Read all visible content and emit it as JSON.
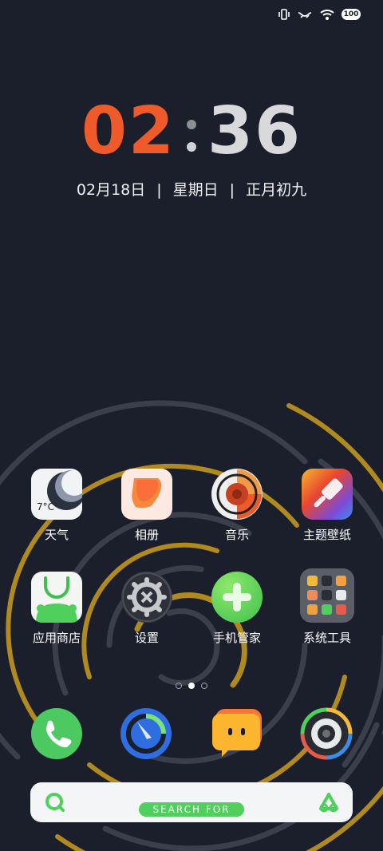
{
  "status_bar": {
    "icons": [
      "vibrate-icon",
      "hotspot-icon",
      "wifi-icon",
      "battery-icon"
    ],
    "battery": "100"
  },
  "clock": {
    "hours": "02",
    "minutes": "36"
  },
  "date": {
    "day": "02月18日",
    "weekday": "星期日",
    "lunar": "正月初九"
  },
  "apps_row1": [
    {
      "label": "天气",
      "icon": "weather-icon",
      "temp": "7°C"
    },
    {
      "label": "相册",
      "icon": "gallery-icon"
    },
    {
      "label": "音乐",
      "icon": "music-icon"
    },
    {
      "label": "主题壁纸",
      "icon": "theme-icon"
    }
  ],
  "apps_row2": [
    {
      "label": "应用商店",
      "icon": "app-store-icon"
    },
    {
      "label": "设置",
      "icon": "settings-icon"
    },
    {
      "label": "手机管家",
      "icon": "phone-manager-icon"
    },
    {
      "label": "系统工具",
      "icon": "system-tools-folder-icon"
    }
  ],
  "page_indicator": {
    "pages": 3,
    "current": 2
  },
  "dock": [
    "phone-icon",
    "browser-icon",
    "messages-icon",
    "camera-icon"
  ],
  "search": {
    "placeholder": "SEARCH FOR",
    "left_icon": "search-icon",
    "right_icon": "assistant-icon"
  },
  "colors": {
    "accent_orange": "#ee5a2a",
    "background": "#1b1f2b",
    "green": "#4fcf5b"
  }
}
